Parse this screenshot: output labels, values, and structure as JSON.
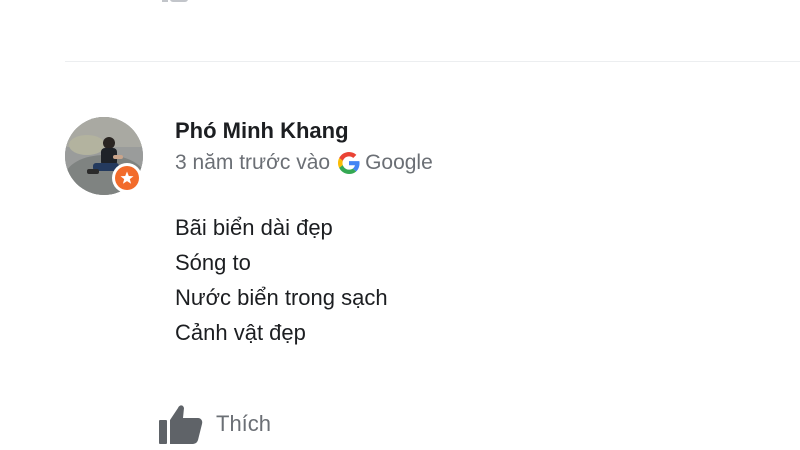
{
  "review": {
    "author_name": "Phó Minh Khang",
    "time_ago": "3 năm trước vào",
    "source": "Google",
    "lines": [
      "Bãi biển dài đẹp",
      "Sóng to",
      "Nước biển trong sạch",
      "Cảnh vật đẹp"
    ]
  },
  "actions": {
    "like_label": "Thích"
  },
  "icons": {
    "badge": "local-guide-star-icon",
    "source": "google-g-icon",
    "like": "thumbs-up-icon"
  },
  "colors": {
    "badge_orange": "#f26b2b",
    "meta_gray": "#6b6f75",
    "text_dark": "#1c1e21",
    "divider": "#eceef0"
  }
}
